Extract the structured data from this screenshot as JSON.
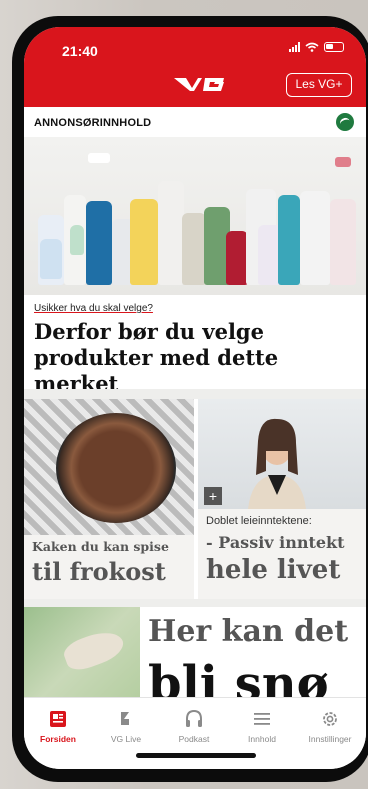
{
  "status": {
    "time": "21:40"
  },
  "header": {
    "logo_text": "VG",
    "plus_button": "Les VG+"
  },
  "ad_section": {
    "label": "ANNONSØRINNHOLD",
    "kicker": "Usikker hva du skal velge?",
    "headline": "Derfor bør du velge produkter med dette merket"
  },
  "cards": [
    {
      "title_small": "Kaken du kan spise",
      "title_big": "til frokost"
    },
    {
      "kicker": "Doblet leieinntektene:",
      "title_small": "- Passiv inntekt",
      "title_big": "hele livet",
      "badge": "+"
    }
  ],
  "bottom_story": {
    "title_small": "Her kan det",
    "title_big": "bli snø"
  },
  "tabs": [
    {
      "label": "Forsiden",
      "icon": "front-page-icon",
      "active": true
    },
    {
      "label": "VG Live",
      "icon": "live-icon",
      "active": false
    },
    {
      "label": "Podkast",
      "icon": "headphones-icon",
      "active": false
    },
    {
      "label": "Innhold",
      "icon": "menu-icon",
      "active": false
    },
    {
      "label": "Innstillinger",
      "icon": "gear-icon",
      "active": false
    }
  ],
  "colors": {
    "brand_red": "#d9151c",
    "ecolabel_green": "#1f7a3f"
  }
}
